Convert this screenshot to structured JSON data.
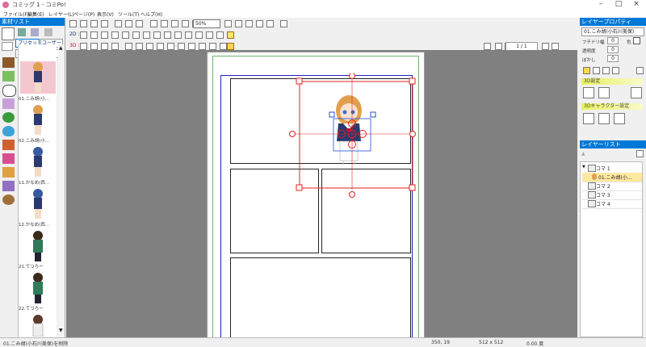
{
  "window": {
    "title": "コミッグ 1 - コミPo!",
    "minimize": "–",
    "maximize": "□",
    "close": "×"
  },
  "menu": [
    "ファイル(F)",
    "編集(E)",
    "レイヤー(L)",
    "ページ(P)",
    "表示(V)",
    "ツール(T)",
    "ヘルプ(H)"
  ],
  "toolbar": {
    "zoom": "50%",
    "row2_label": "2D :",
    "row3_label": "3D :",
    "page_counter": "1 / 1"
  },
  "left_panel": {
    "title": "素材リスト",
    "preset_button": "プリセット",
    "user_button": "ユーザー",
    "category": "01 コミPo!",
    "materials": [
      "01.こみ胡(小…",
      "02.こみ胡(小…",
      "11.かなめ(西…",
      "12.かなめ(西…",
      "21.てつろー",
      "22.てつろー",
      ""
    ]
  },
  "right_panel": {
    "layer_props_title": "レイヤープロパティ",
    "layer_name": "01.こみ胡(小石川美保)",
    "frame_width_label": "フチドリ幅",
    "frame_width_value": "0",
    "color_label": "色",
    "opacity_label": "透明度",
    "opacity_value": "0",
    "blur_label": "ぼかし",
    "blur_value": "0",
    "section_3d": "3D設定",
    "section_3d_char": "3Dキャラクター設定",
    "layer_list_title": "レイヤーリスト",
    "layers": [
      {
        "name": "コマ 1",
        "expanded": true
      },
      {
        "name": "01.こみ胡(小…",
        "child": true,
        "selected": true
      },
      {
        "name": "コマ 2"
      },
      {
        "name": "コマ 3"
      },
      {
        "name": "コマ 4"
      }
    ]
  },
  "status": {
    "message": "01.こみ胡(小石川美保)を削除",
    "coords": "350, 19",
    "size": "512 x 512",
    "angle": "0.00 度"
  }
}
